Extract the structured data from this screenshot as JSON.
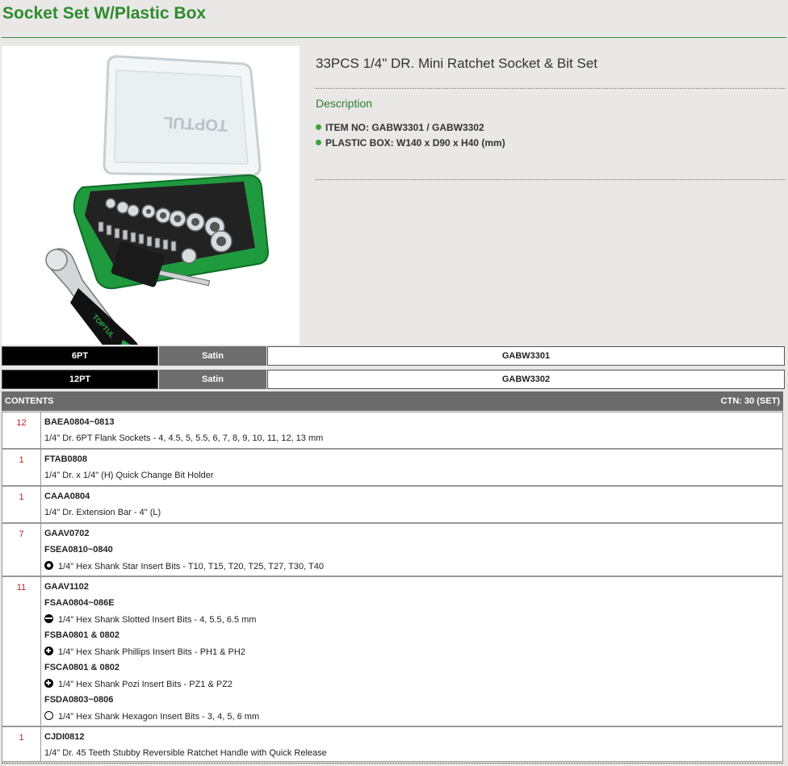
{
  "page": {
    "title": "Socket Set W/Plastic Box"
  },
  "product": {
    "name": "33PCS 1/4\" DR. Mini Ratchet Socket & Bit Set",
    "description_title": "Description",
    "specs": [
      "ITEM NO: GABW3301 / GABW3302",
      "PLASTIC BOX: W140 x D90 x H40 (mm)"
    ],
    "image_brand": "TOPTUL"
  },
  "variants": [
    {
      "pt": "6PT",
      "finish": "Satin",
      "code": "GABW3301"
    },
    {
      "pt": "12PT",
      "finish": "Satin",
      "code": "GABW3302"
    }
  ],
  "contents": {
    "header": "CONTENTS",
    "ctn": "CTN: 30 (SET)",
    "rows": [
      {
        "qty": "12",
        "lines": [
          {
            "type": "code",
            "text": "BAEA0804~0813"
          },
          {
            "type": "desc",
            "text": "1/4\" Dr. 6PT Flank Sockets - 4, 4.5, 5, 5.5, 6, 7, 8, 9, 10, 11, 12, 13 mm"
          }
        ]
      },
      {
        "qty": "1",
        "lines": [
          {
            "type": "code",
            "text": "FTAB0808"
          },
          {
            "type": "desc",
            "text": "1/4\" Dr. x 1/4\" (H) Quick Change Bit Holder"
          }
        ]
      },
      {
        "qty": "1",
        "lines": [
          {
            "type": "code",
            "text": "CAAA0804"
          },
          {
            "type": "desc",
            "text": "1/4\" Dr. Extension Bar - 4\" (L)"
          }
        ]
      },
      {
        "qty": "7",
        "lines": [
          {
            "type": "code",
            "text": "GAAV0702"
          },
          {
            "type": "code",
            "text": "FSEA0810~0840"
          },
          {
            "type": "desc",
            "icon": "star",
            "text": "1/4\" Hex Shank Star Insert Bits - T10, T15, T20, T25, T27, T30, T40"
          }
        ]
      },
      {
        "qty": "11",
        "lines": [
          {
            "type": "code",
            "text": "GAAV1102"
          },
          {
            "type": "code",
            "text": "FSAA0804~086E"
          },
          {
            "type": "desc",
            "icon": "slot",
            "text": "1/4\" Hex Shank Slotted Insert Bits - 4, 5.5, 6.5 mm"
          },
          {
            "type": "code",
            "text": "FSBA0801 & 0802"
          },
          {
            "type": "desc",
            "icon": "plus",
            "text": "1/4\" Hex Shank Phillips Insert Bits - PH1 & PH2"
          },
          {
            "type": "code",
            "text": "FSCA0801 & 0802"
          },
          {
            "type": "desc",
            "icon": "plus",
            "text": "1/4\" Hex Shank Pozi Insert Bits - PZ1 & PZ2"
          },
          {
            "type": "code",
            "text": "FSDA0803~0806"
          },
          {
            "type": "desc",
            "icon": "hex",
            "text": "1/4\" Hex Shank Hexagon Insert Bits - 3, 4, 5, 6 mm"
          }
        ]
      },
      {
        "qty": "1",
        "lines": [
          {
            "type": "code",
            "text": "CJDI0812"
          },
          {
            "type": "desc",
            "text": "1/4\" Dr. 45 Teeth Stubby Reversible Ratchet Handle with Quick Release"
          }
        ]
      }
    ]
  }
}
